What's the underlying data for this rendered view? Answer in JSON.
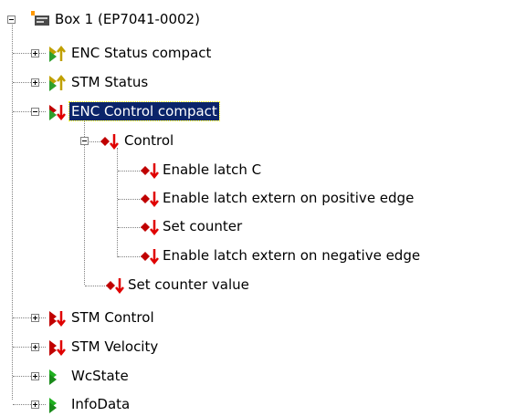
{
  "tree": {
    "root": {
      "label": "Box 1 (EP7041-0002)",
      "icon": "box-module-icon"
    },
    "items": [
      {
        "label": "ENC Status compact",
        "icon": "input-status-icon",
        "expanded": false
      },
      {
        "label": "STM Status",
        "icon": "input-status-icon",
        "expanded": false
      },
      {
        "label": "ENC Control compact",
        "icon": "output-control-icon",
        "expanded": true,
        "selected": true
      },
      {
        "label": "Control",
        "icon": "output-variable-icon",
        "expanded": true
      },
      {
        "label": "Enable latch C",
        "icon": "output-variable-icon"
      },
      {
        "label": "Enable latch extern on positive edge",
        "icon": "output-variable-icon"
      },
      {
        "label": "Set counter",
        "icon": "output-variable-icon"
      },
      {
        "label": "Enable latch extern on negative edge",
        "icon": "output-variable-icon"
      },
      {
        "label": "Set counter value",
        "icon": "output-variable-icon"
      },
      {
        "label": "STM Control",
        "icon": "output-control-icon",
        "expanded": false
      },
      {
        "label": "STM Velocity",
        "icon": "output-control-icon",
        "expanded": false
      },
      {
        "label": "WcState",
        "icon": "state-icon",
        "expanded": false
      },
      {
        "label": "InfoData",
        "icon": "state-icon",
        "expanded": false
      }
    ]
  },
  "colors": {
    "selection": "#0a246a",
    "input": "#d6d600",
    "output": "#cc0000",
    "state": "#20b020"
  }
}
